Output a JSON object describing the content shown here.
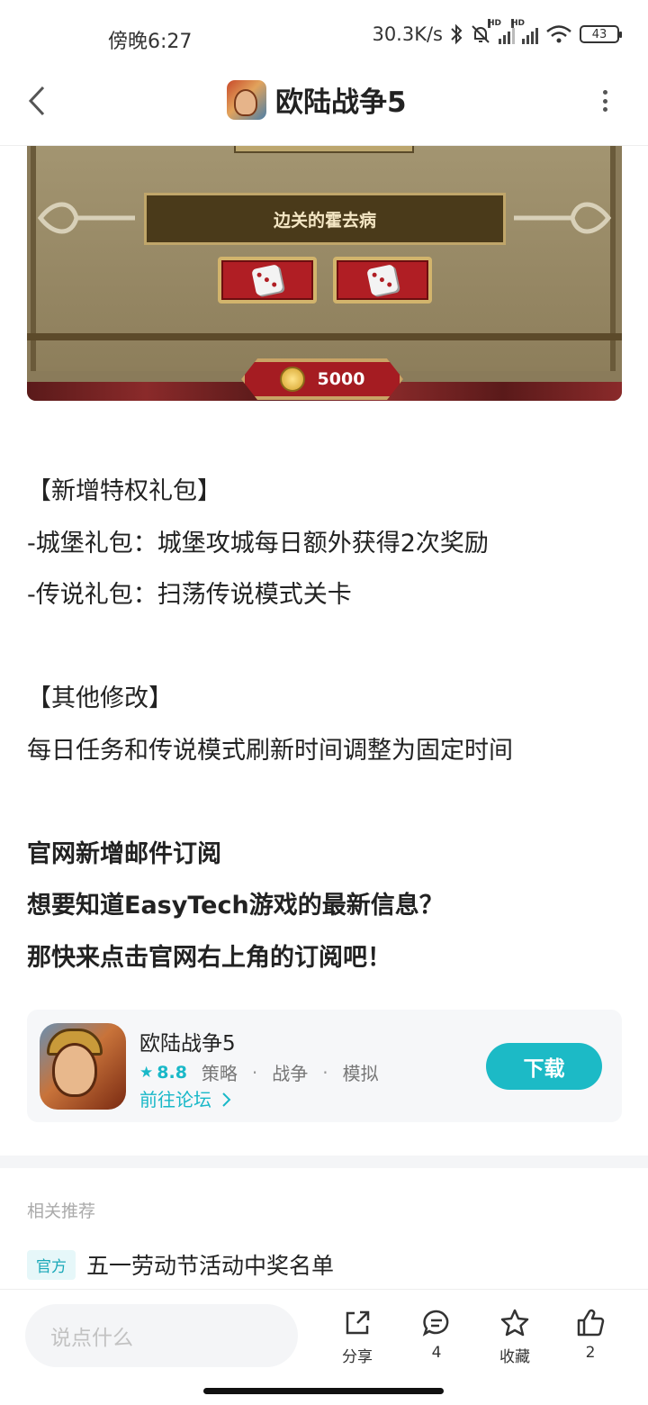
{
  "status_bar": {
    "time": "傍晚6:27",
    "speed": "30.3K/s",
    "battery": "43",
    "hd_label": "HD"
  },
  "header": {
    "title": "欧陆战争5"
  },
  "game_image": {
    "label": "边关的霍去病",
    "coins": "5000"
  },
  "article": {
    "lines": [
      "【新增特权礼包】",
      "-城堡礼包：城堡攻城每日额外获得2次奖励",
      "-传说礼包：扫荡传说模式关卡",
      "【其他修改】",
      "每日任务和传说模式刷新时间调整为固定时间",
      "官网新增邮件订阅",
      "想要知道EasyTech游戏的最新信息？",
      "那快来点击官网右上角的订阅吧！"
    ]
  },
  "app_card": {
    "name": "欧陆战争5",
    "score": "8.8",
    "tags": [
      "策略",
      "战争",
      "模拟"
    ],
    "forum_link": "前往论坛",
    "download_label": "下载"
  },
  "related": {
    "title": "相关推荐",
    "tag": "官方",
    "item_title": "五一劳动节活动中奖名单"
  },
  "bottom_bar": {
    "comment_placeholder": "说点什么",
    "share_label": "分享",
    "comment_count": "4",
    "favorite_label": "收藏",
    "like_count": "2"
  },
  "colors": {
    "accent": "#1cbac6",
    "text": "#222222",
    "muted": "#aaaaaa"
  }
}
